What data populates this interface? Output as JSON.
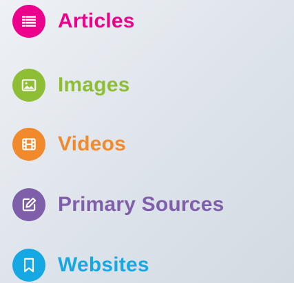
{
  "items": [
    {
      "label": "Articles",
      "icon": "list-icon",
      "color": "#ec008c"
    },
    {
      "label": "Images",
      "icon": "image-icon",
      "color": "#8dbe35"
    },
    {
      "label": "Videos",
      "icon": "film-icon",
      "color": "#f08a2c"
    },
    {
      "label": "Primary Sources",
      "icon": "edit-icon",
      "color": "#7f5fa9"
    },
    {
      "label": "Websites",
      "icon": "bookmark-icon",
      "color": "#16a8e2"
    }
  ]
}
